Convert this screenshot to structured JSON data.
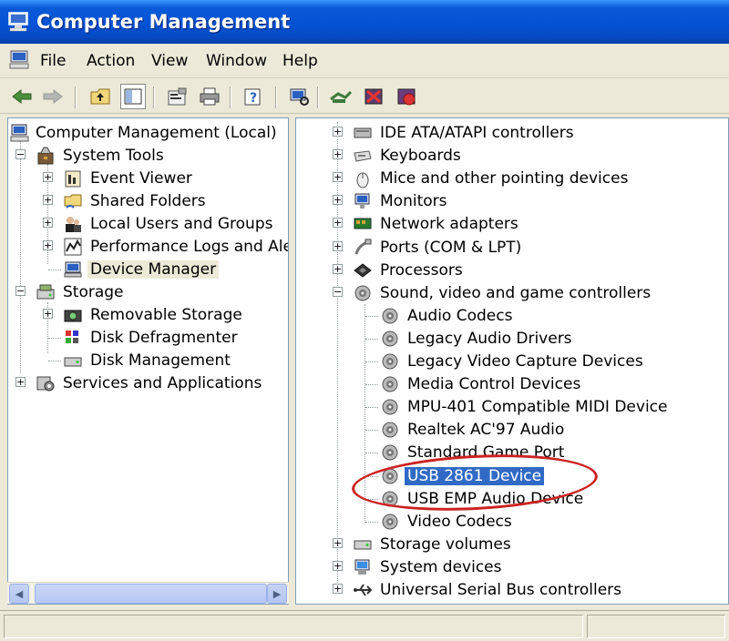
{
  "window": {
    "title": "Computer Management"
  },
  "menu": [
    "File",
    "Action",
    "View",
    "Window",
    "Help"
  ],
  "toolbar": {
    "buttons": [
      "back-icon",
      "forward-icon",
      "up-icon",
      "show-hide-tree-icon",
      "properties-icon",
      "print-icon",
      "help-icon",
      "scan-hardware-icon",
      "update-driver-icon",
      "uninstall-icon",
      "disable-icon"
    ]
  },
  "left_tree": [
    {
      "label": "Computer Management (Local)",
      "icon": "computer-management-icon"
    },
    {
      "label": "System Tools",
      "icon": "system-tools-icon"
    },
    {
      "label": "Event Viewer",
      "icon": "event-viewer-icon"
    },
    {
      "label": "Shared Folders",
      "icon": "shared-folders-icon"
    },
    {
      "label": "Local Users and Groups",
      "icon": "users-icon"
    },
    {
      "label": "Performance Logs and Alerts",
      "icon": "performance-icon"
    },
    {
      "label": "Device Manager",
      "icon": "device-manager-icon"
    },
    {
      "label": "Storage",
      "icon": "storage-icon"
    },
    {
      "label": "Removable Storage",
      "icon": "removable-storage-icon"
    },
    {
      "label": "Disk Defragmenter",
      "icon": "defragmenter-icon"
    },
    {
      "label": "Disk Management",
      "icon": "disk-management-icon"
    },
    {
      "label": "Services and Applications",
      "icon": "services-icon"
    }
  ],
  "right_tree": [
    {
      "label": "IDE ATA/ATAPI controllers",
      "icon": "ide-controller-icon"
    },
    {
      "label": "Keyboards",
      "icon": "keyboard-icon"
    },
    {
      "label": "Mice and other pointing devices",
      "icon": "mouse-icon"
    },
    {
      "label": "Monitors",
      "icon": "monitor-icon"
    },
    {
      "label": "Network adapters",
      "icon": "network-adapter-icon"
    },
    {
      "label": "Ports (COM & LPT)",
      "icon": "port-icon"
    },
    {
      "label": "Processors",
      "icon": "processor-icon"
    },
    {
      "label": "Sound, video and game controllers",
      "icon": "sound-icon"
    },
    {
      "label": "Audio Codecs",
      "icon": "sound-device-icon"
    },
    {
      "label": "Legacy Audio Drivers",
      "icon": "sound-device-icon"
    },
    {
      "label": "Legacy Video Capture Devices",
      "icon": "sound-device-icon"
    },
    {
      "label": "Media Control Devices",
      "icon": "sound-device-icon"
    },
    {
      "label": "MPU-401 Compatible MIDI Device",
      "icon": "sound-device-icon"
    },
    {
      "label": "Realtek AC'97 Audio",
      "icon": "sound-device-icon"
    },
    {
      "label": "Standard Game Port",
      "icon": "sound-device-icon"
    },
    {
      "label": "USB 2861 Device",
      "icon": "sound-device-icon"
    },
    {
      "label": "USB EMP Audio Device",
      "icon": "sound-device-icon"
    },
    {
      "label": "Video Codecs",
      "icon": "sound-device-icon"
    },
    {
      "label": "Storage volumes",
      "icon": "storage-volume-icon"
    },
    {
      "label": "System devices",
      "icon": "system-devices-icon"
    },
    {
      "label": "Universal Serial Bus controllers",
      "icon": "usb-icon"
    }
  ],
  "colors": {
    "title_bar": "#0453d6",
    "selection": "#316ac5",
    "annotation": "#cc2222"
  }
}
